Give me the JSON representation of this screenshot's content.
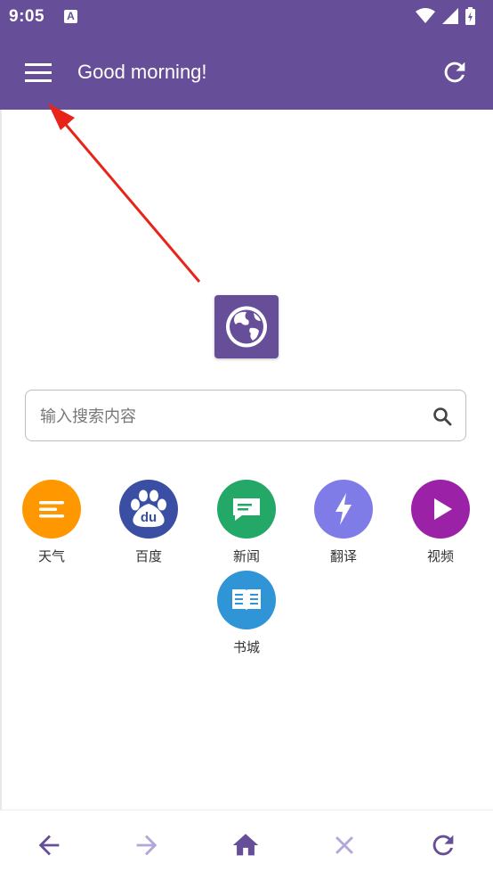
{
  "status_bar": {
    "time": "9:05",
    "notification_icon": "A"
  },
  "app_bar": {
    "title": "Good morning!",
    "menu_icon": "menu-icon",
    "refresh_icon": "refresh-icon",
    "background_color": "#664e98"
  },
  "search": {
    "placeholder": "输入搜索内容",
    "value": ""
  },
  "shortcuts": [
    {
      "label": "天气",
      "icon": "weather-icon",
      "color": "#ff9800"
    },
    {
      "label": "百度",
      "icon": "baidu-icon",
      "color": "#3a4fa3"
    },
    {
      "label": "新闻",
      "icon": "news-icon",
      "color": "#23a867"
    },
    {
      "label": "翻译",
      "icon": "translate-icon",
      "color": "#7f7ce8"
    },
    {
      "label": "视频",
      "icon": "video-icon",
      "color": "#9b22a6"
    },
    {
      "label": "书城",
      "icon": "book-icon",
      "color": "#2f95d6"
    }
  ],
  "baidu_logo_text": "du",
  "bottom_nav": {
    "back": {
      "icon": "arrow-left-icon",
      "enabled": true
    },
    "forward": {
      "icon": "arrow-right-icon",
      "enabled": false
    },
    "home": {
      "icon": "home-icon",
      "enabled": true
    },
    "close": {
      "icon": "close-icon",
      "enabled": false
    },
    "reload": {
      "icon": "reload-icon",
      "enabled": true
    }
  },
  "colors": {
    "accent": "#664e98",
    "disabled": "#b3a6d9",
    "annotation_arrow": "#e8241a"
  }
}
